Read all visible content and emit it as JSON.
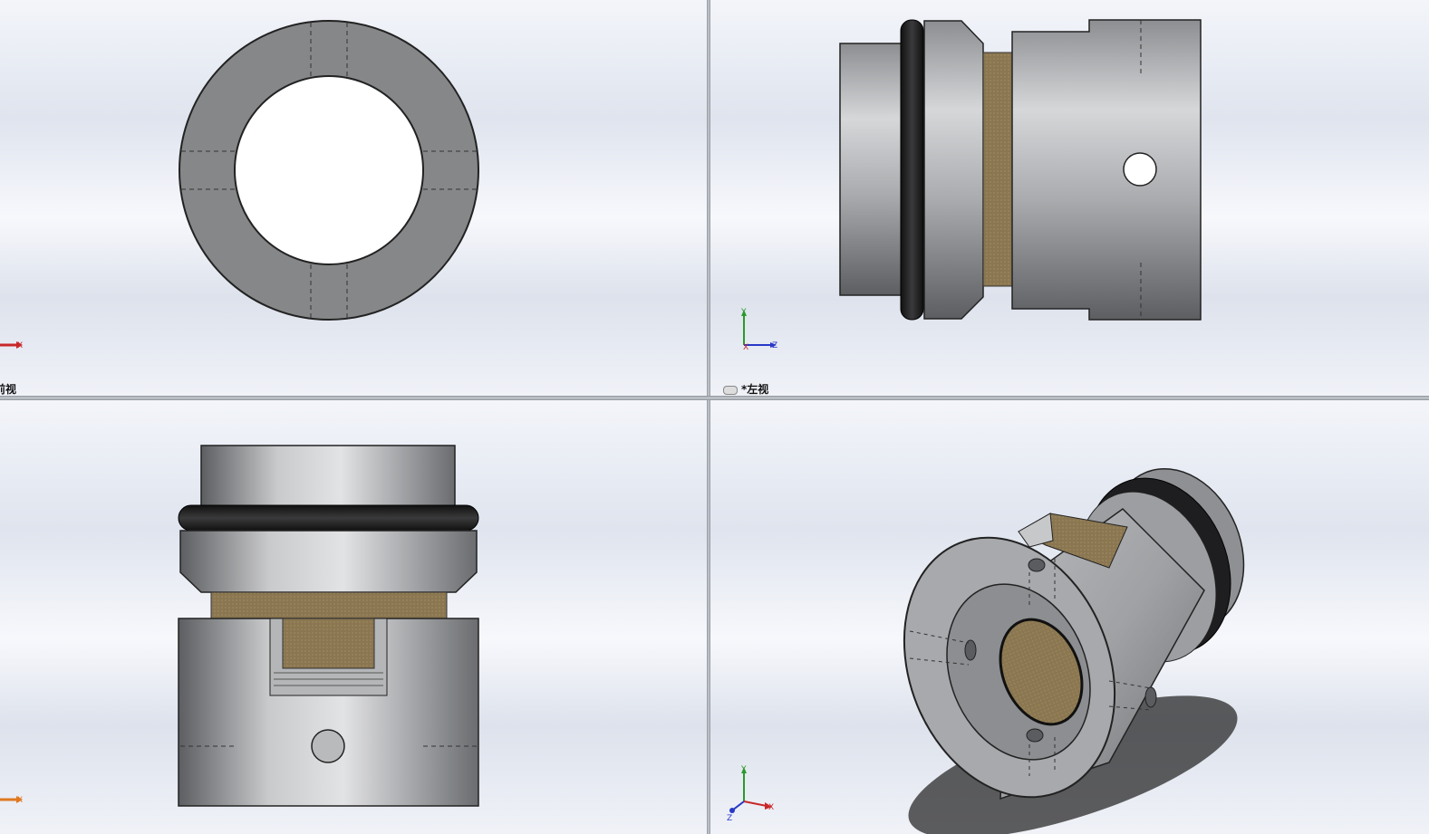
{
  "views": {
    "front": {
      "label": "前视"
    },
    "left": {
      "label": "*左视"
    },
    "top": {
      "label": ""
    },
    "iso": {
      "label": ""
    }
  },
  "axes": {
    "x": "X",
    "y": "Y",
    "z": "Z"
  },
  "colors": {
    "axis_x": "#c8282a",
    "axis_y": "#2a9a2a",
    "axis_z": "#2838c8",
    "steel": "#9a9ca0",
    "oring": "#1e1e20",
    "bronze": "#8a7650"
  },
  "icons": [
    "triad-icon",
    "link-icon"
  ]
}
